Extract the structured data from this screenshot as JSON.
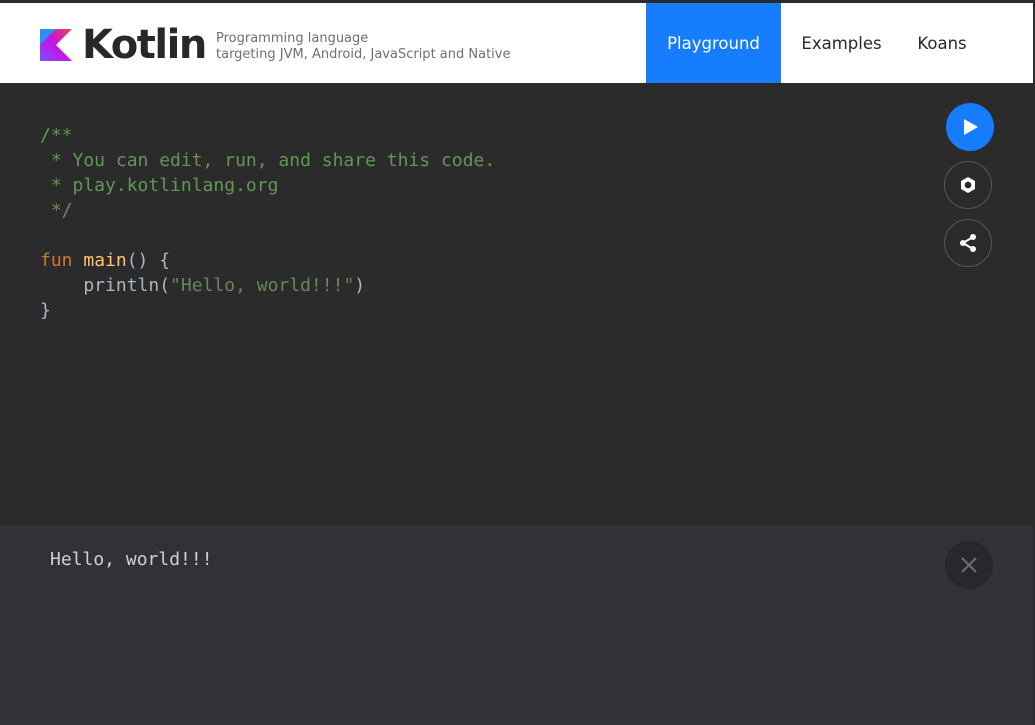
{
  "header": {
    "brand": "Kotlin",
    "tagline_line1": "Programming language",
    "tagline_line2": "targeting JVM, Android, JavaScript and Native",
    "nav": [
      {
        "label": "Playground",
        "active": true
      },
      {
        "label": "Examples",
        "active": false
      },
      {
        "label": "Koans",
        "active": false
      }
    ]
  },
  "editor": {
    "lines": {
      "l1": "/**",
      "l2": " * You can edit, run, and share this code.",
      "l3": " * play.kotlinlang.org",
      "l4": " */",
      "l6_kw": "fun",
      "l6_fn": "main",
      "l6_rest": "() {",
      "l7_call": "    println(",
      "l7_str": "\"Hello, world!!!\"",
      "l7_end": ")",
      "l8": "}"
    },
    "actions": {
      "run_icon": "play-icon",
      "settings_icon": "settings-icon",
      "share_icon": "share-icon"
    }
  },
  "output": {
    "text": "Hello, world!!!",
    "close_icon": "close-icon"
  },
  "colors": {
    "accent": "#167dff",
    "editor_bg": "#2b2b2b",
    "output_bg": "#313236",
    "comment": "#629755",
    "keyword": "#cc7832",
    "function": "#ffc66d",
    "string": "#6a8759"
  }
}
